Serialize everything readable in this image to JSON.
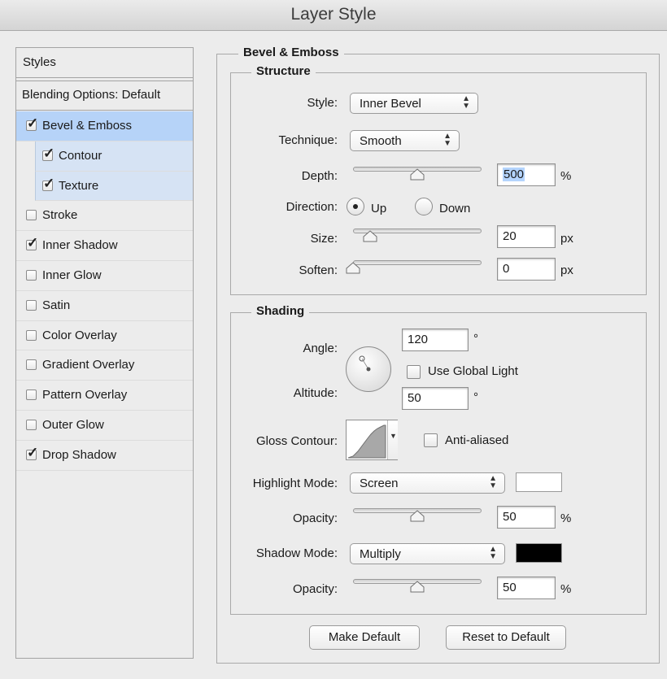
{
  "window": {
    "title": "Layer Style"
  },
  "sidebar": {
    "header": "Styles",
    "blending": "Blending Options: Default",
    "items": [
      {
        "label": "Bevel & Emboss",
        "checked": true,
        "selected": true
      },
      {
        "label": "Contour",
        "checked": true,
        "sub": true
      },
      {
        "label": "Texture",
        "checked": true,
        "sub": true
      },
      {
        "label": "Stroke",
        "checked": false
      },
      {
        "label": "Inner Shadow",
        "checked": true
      },
      {
        "label": "Inner Glow",
        "checked": false
      },
      {
        "label": "Satin",
        "checked": false
      },
      {
        "label": "Color Overlay",
        "checked": false
      },
      {
        "label": "Gradient Overlay",
        "checked": false
      },
      {
        "label": "Pattern Overlay",
        "checked": false
      },
      {
        "label": "Outer Glow",
        "checked": false
      },
      {
        "label": "Drop Shadow",
        "checked": true
      }
    ]
  },
  "panel": {
    "title": "Bevel & Emboss"
  },
  "structure": {
    "title": "Structure",
    "style_label": "Style:",
    "style_value": "Inner Bevel",
    "technique_label": "Technique:",
    "technique_value": "Smooth",
    "depth_label": "Depth:",
    "depth_value": "500",
    "depth_unit": "%",
    "depth_slider": 0.5,
    "direction_label": "Direction:",
    "direction_up": "Up",
    "direction_down": "Down",
    "direction_selected": "Up",
    "size_label": "Size:",
    "size_value": "20",
    "size_unit": "px",
    "size_slider": 0.13,
    "soften_label": "Soften:",
    "soften_value": "0",
    "soften_unit": "px",
    "soften_slider": 0.0
  },
  "shading": {
    "title": "Shading",
    "angle_label": "Angle:",
    "angle_value": "120",
    "angle_unit": "°",
    "use_global_light": "Use Global Light",
    "use_global_light_checked": false,
    "altitude_label": "Altitude:",
    "altitude_value": "50",
    "altitude_unit": "°",
    "gloss_contour_label": "Gloss Contour:",
    "anti_aliased": "Anti-aliased",
    "anti_aliased_checked": false,
    "highlight_mode_label": "Highlight Mode:",
    "highlight_mode_value": "Screen",
    "highlight_color": "#ffffff",
    "highlight_opacity_label": "Opacity:",
    "highlight_opacity_value": "50",
    "highlight_opacity_unit": "%",
    "highlight_opacity_slider": 0.5,
    "shadow_mode_label": "Shadow Mode:",
    "shadow_mode_value": "Multiply",
    "shadow_color": "#000000",
    "shadow_opacity_label": "Opacity:",
    "shadow_opacity_value": "50",
    "shadow_opacity_unit": "%",
    "shadow_opacity_slider": 0.5
  },
  "buttons": {
    "make_default": "Make Default",
    "reset_default": "Reset to Default"
  }
}
